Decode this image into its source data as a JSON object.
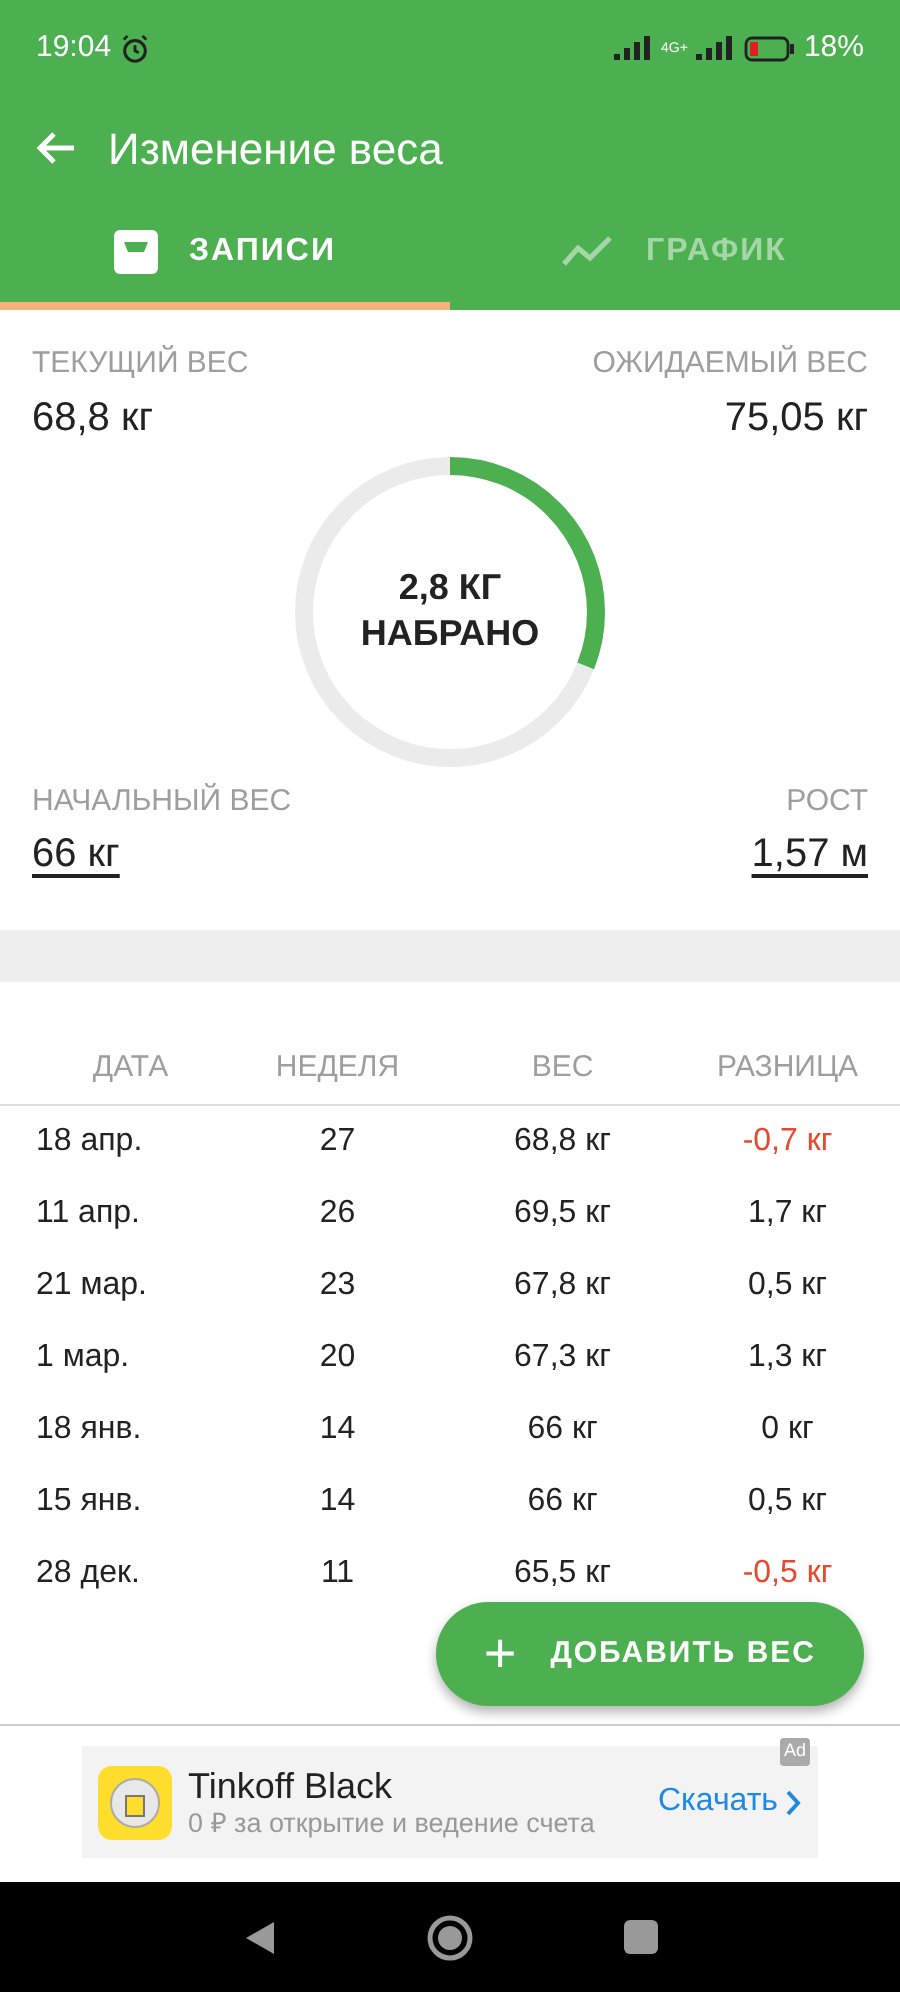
{
  "status_bar": {
    "time": "19:04",
    "network": "4G+",
    "battery": "18%"
  },
  "toolbar": {
    "title": "Изменение веса"
  },
  "tabs": [
    {
      "label": "ЗАПИСИ",
      "selected": true,
      "kind": "scale"
    },
    {
      "label": "ГРАФИК",
      "selected": false,
      "kind": "chart"
    }
  ],
  "summary": {
    "current": {
      "label": "ТЕКУЩИЙ ВЕС",
      "value": "68,8 кг"
    },
    "target": {
      "label": "ОЖИДАЕМЫЙ ВЕС",
      "value": "75,05 кг"
    },
    "progress": {
      "level": 0.31,
      "line_1": "2,8 КГ",
      "line_2": "НАБРАНО"
    },
    "start": {
      "label": "НАЧАЛЬНЫЙ ВЕС",
      "value": "66 кг"
    },
    "height": {
      "label": "РОСТ",
      "value": "1,57 м"
    }
  },
  "table": {
    "columns": [
      "ДАТА",
      "НЕДЕЛЯ",
      "ВЕС",
      "РАЗНИЦА"
    ],
    "rows": [
      {
        "cells": [
          "18 апр.",
          "27",
          "68,8 кг",
          "-0,7 кг"
        ],
        "color": "#e6492d"
      },
      {
        "cells": [
          "11 апр.",
          "26",
          "69,5 кг",
          "1,7 кг"
        ],
        "color": "#222222"
      },
      {
        "cells": [
          "21 мар.",
          "23",
          "67,8 кг",
          "0,5 кг"
        ],
        "color": "#222222"
      },
      {
        "cells": [
          "1 мар.",
          "20",
          "67,3 кг",
          "1,3 кг"
        ],
        "color": "#222222"
      },
      {
        "cells": [
          "18 янв.",
          "14",
          "66 кг",
          "0 кг"
        ],
        "color": "#222222"
      },
      {
        "cells": [
          "15 янв.",
          "14",
          "66 кг",
          "0,5 кг"
        ],
        "color": "#222222"
      },
      {
        "cells": [
          "28 дек.",
          "11",
          "65,5 кг",
          "-0,5 кг"
        ],
        "color": "#e6492d"
      }
    ]
  },
  "fab": {
    "icon": "+",
    "label": "ДОБАВИТЬ ВЕС"
  },
  "ad": {
    "title": "Tinkoff Black",
    "subtitle": "0 ₽ за открытие и ведение счета",
    "action": "Скачать",
    "badge": "Ad"
  }
}
